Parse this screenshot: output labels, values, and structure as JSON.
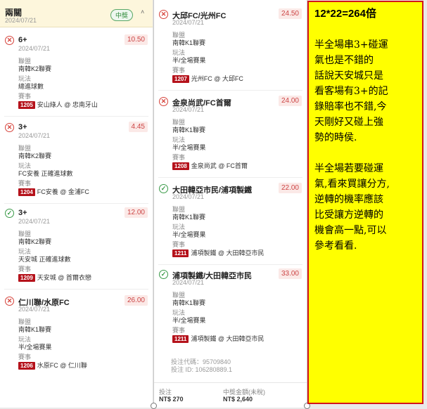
{
  "summary": {
    "title": "兩關",
    "date": "2024/07/21",
    "status_badge": "中獎"
  },
  "labels": {
    "league": "聯盟",
    "play": "玩法",
    "match": "賽事"
  },
  "col1_legs": [
    {
      "result": "lost",
      "selection": "6+",
      "date": "2024/07/21",
      "odds": "10.50",
      "league": "南韓K2聯賽",
      "play": "總進球數",
      "match_id": "1205",
      "match": "安山綠人 @ 忠南牙山"
    },
    {
      "result": "lost",
      "selection": "3+",
      "date": "2024/07/21",
      "odds": "4.45",
      "league": "南韓K2聯賽",
      "play": "FC安養 正確進球數",
      "match_id": "1204",
      "match": "FC安養 @ 金浦FC"
    },
    {
      "result": "won",
      "selection": "3+",
      "date": "2024/07/21",
      "odds": "12.00",
      "league": "南韓K2聯賽",
      "play": "天安城 正確進球數",
      "match_id": "1209",
      "match": "天安城 @ 首爾衣戀"
    },
    {
      "result": "lost",
      "selection": "仁川聯/水原FC",
      "date": "2024/07/21",
      "odds": "26.00",
      "league": "南韓K1聯賽",
      "play": "半/全場賽果",
      "match_id": "1206",
      "match": "水原FC @ 仁川聯"
    }
  ],
  "col2_legs": [
    {
      "result": "lost",
      "selection": "大邱FC/光州FC",
      "date": "2024/07/21",
      "odds": "24.50",
      "league": "南韓K1聯賽",
      "play": "半/全場賽果",
      "match_id": "1207",
      "match": "光州FC @ 大邱FC"
    },
    {
      "result": "lost",
      "selection": "金泉尚武/FC首爾",
      "date": "2024/07/21",
      "odds": "24.00",
      "league": "南韓K1聯賽",
      "play": "半/全場賽果",
      "match_id": "1208",
      "match": "金泉尚武 @ FC首爾"
    },
    {
      "result": "won",
      "selection": "大田韓亞市民/浦項製鐵",
      "date": "2024/07/21",
      "odds": "22.00",
      "league": "南韓K1聯賽",
      "play": "半/全場賽果",
      "match_id": "1211",
      "match": "浦項製鐵 @ 大田韓亞市民"
    },
    {
      "result": "won",
      "selection": "浦項製鐵/大田韓亞市民",
      "date": "2024/07/21",
      "odds": "33.00",
      "league": "南韓K1聯賽",
      "play": "半/全場賽果",
      "match_id": "1211",
      "match": "浦項製鐵 @ 大田韓亞市民"
    }
  ],
  "footer": {
    "bet_code": "投注代碼：95709840",
    "bet_id": "投注 ID: 106280889.1",
    "stake_label": "投注",
    "stake_value": "NT$ 270",
    "payout_label": "中獎金額(未稅)",
    "payout_value": "NT$ 2,640"
  },
  "note": {
    "title": "12*22=264倍",
    "para1": [
      "半全場串3+碰運",
      "氣也是不錯的",
      "話說天安城只是",
      "看客場有3+的記",
      "錄賠率也不錯,今",
      "天剛好又碰上強",
      "勢的時侯."
    ],
    "para2": [
      "半全場若要碰運",
      "氣,看來買讓分方,",
      "逆轉的機率應該",
      "比受讓方逆轉的",
      "機會高一點,可以",
      "參考看看."
    ]
  },
  "colors": {
    "lost": "#d6423a",
    "won": "#3a9a48",
    "match_badge": "#b5121b",
    "note_bg": "#ffff00",
    "note_border": "#d3151a"
  },
  "icons": {
    "lost": "x-circle-icon",
    "won": "check-circle-icon",
    "collapse": "chevron-up-icon"
  }
}
